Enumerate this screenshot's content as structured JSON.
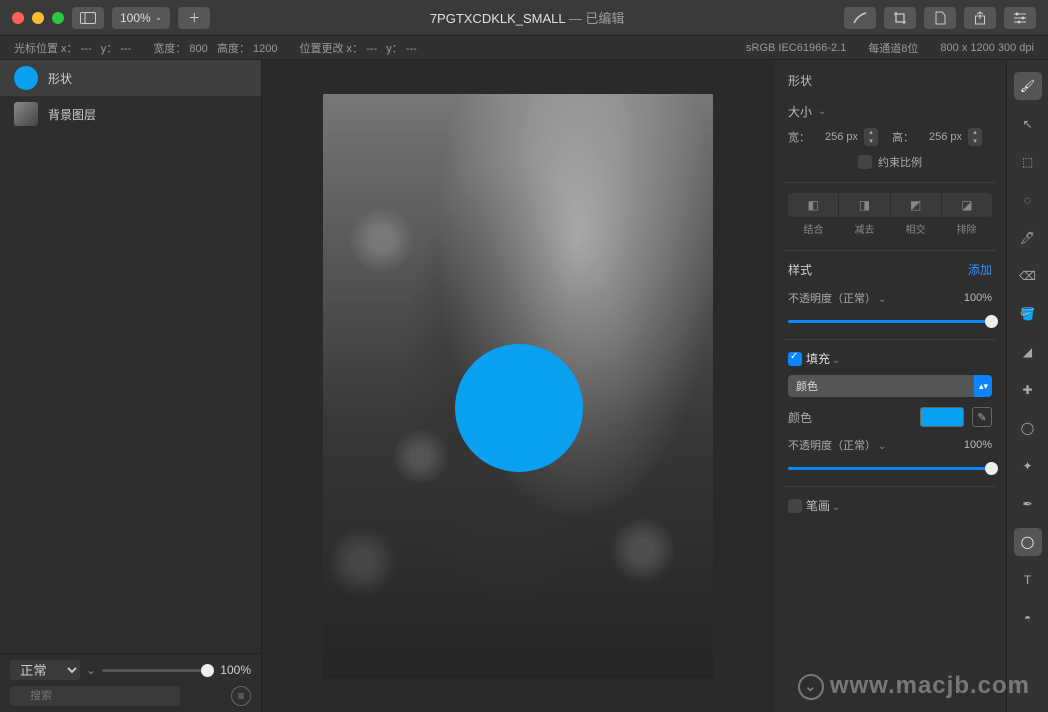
{
  "titlebar": {
    "zoom": "100%",
    "doc_name": "7PGTXCDKLK_SMALL",
    "doc_status": "— 已编辑"
  },
  "infobar": {
    "cursor_label": "光标位置 x：",
    "cursor_x": "---",
    "cursor_y_label": "y：",
    "cursor_y": "---",
    "width_label": "宽度：",
    "width": "800",
    "height_label": "高度：",
    "height": "1200",
    "pos_label": "位置更改 x：",
    "pos_x": "---",
    "pos_y_label": "y：",
    "pos_y": "---",
    "colorspace": "sRGB IEC61966-2.1",
    "depth": "每通道8位",
    "dims": "800 x 1200 300 dpi"
  },
  "layers": {
    "items": [
      {
        "name": "形状"
      },
      {
        "name": "背景图层"
      }
    ],
    "blend_mode": "正常",
    "opacity": "100%",
    "search_placeholder": "搜索"
  },
  "inspector": {
    "title": "形状",
    "size_label": "大小",
    "w_label": "宽：",
    "w_val": "256 px",
    "h_label": "高：",
    "h_val": "256 px",
    "constrain": "约束比例",
    "bool": {
      "unite": "结合",
      "subtract": "减去",
      "intersect": "相交",
      "exclude": "排除"
    },
    "style_label": "样式",
    "add_label": "添加",
    "opacity_label": "不透明度（正常）",
    "opacity_val": "100%",
    "fill_label": "填充",
    "fill_type": "颜色",
    "color_label": "颜色",
    "fill_opacity_label": "不透明度（正常）",
    "fill_opacity_val": "100%",
    "stroke_label": "笔画"
  },
  "watermark": "www.macjb.com"
}
